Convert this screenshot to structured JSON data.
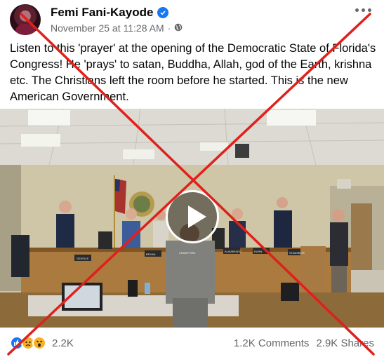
{
  "post": {
    "author": "Femi Fani-Kayode",
    "timestamp": "November 25 at 11:28 AM",
    "separator": "·",
    "text": "Listen to this 'prayer' at the opening of the Democratic State of Florida's Congress! He 'prays' to satan, Buddha, Allah, god of the Earth, krishna etc. The Christians left the room before he started. This is the new American Government."
  },
  "video": {
    "placards": [
      "GENTILE",
      "BRYAN",
      "CRAWFORD",
      "ALAVARADO",
      "KUHN",
      "STANSBOR"
    ]
  },
  "footer": {
    "reaction_count": "2.2K",
    "comments": "1.2K Comments",
    "shares": "2.9K Shares"
  },
  "icons": [
    "verified-icon",
    "globe-icon",
    "more-icon",
    "play-icon",
    "like-reaction-icon",
    "sad-reaction-icon",
    "wow-reaction-icon"
  ],
  "colors": {
    "overlay_x": "#e0201b",
    "brand": "#1877f2",
    "secondary_text": "#65676b"
  }
}
